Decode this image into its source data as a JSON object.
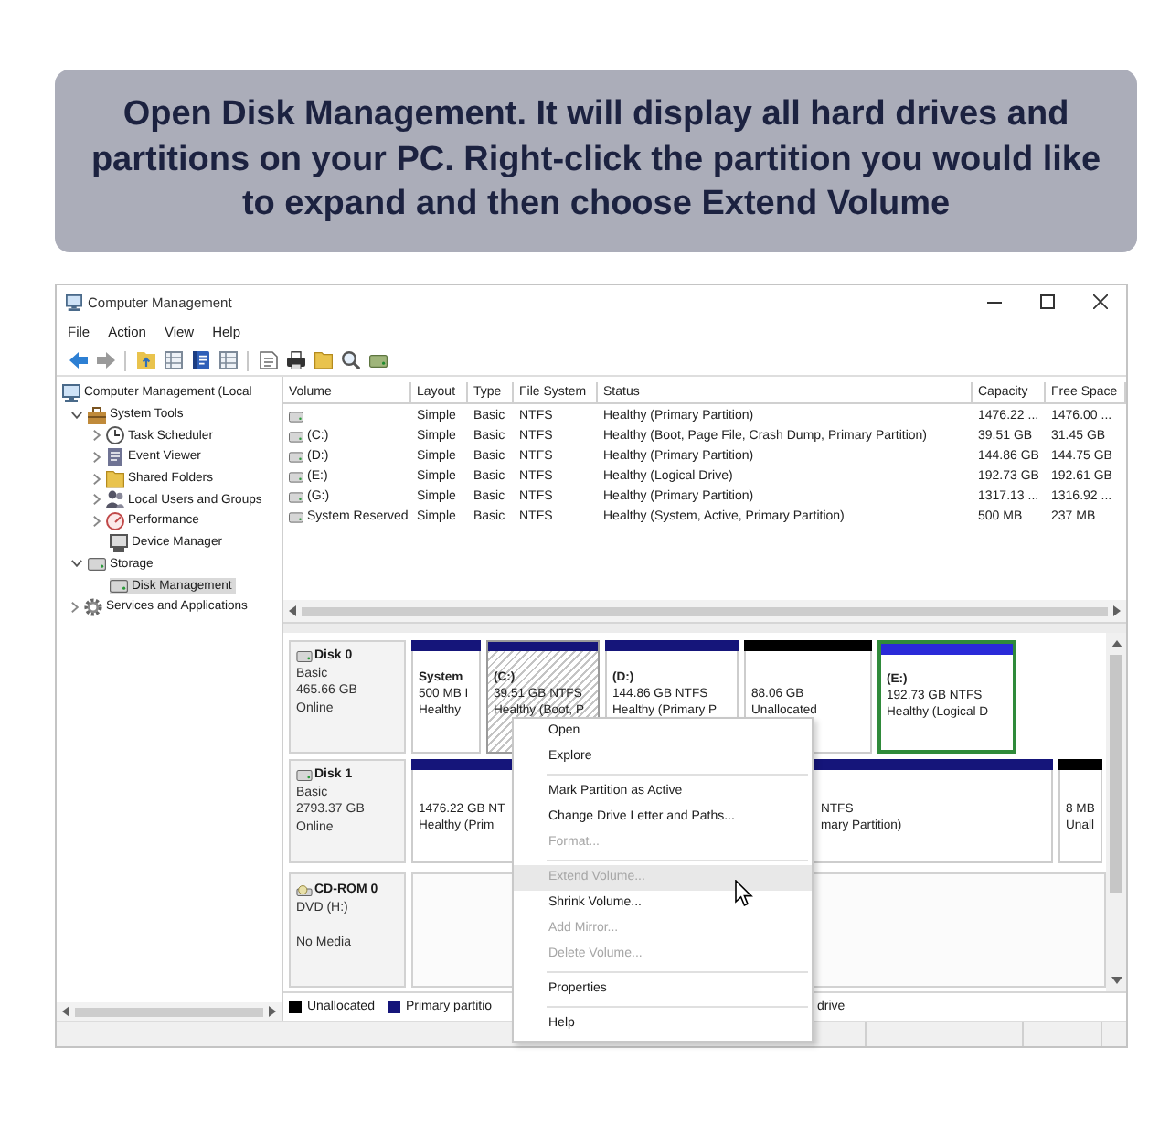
{
  "banner": {
    "text": "Open Disk Management. It will display all hard drives and partitions on your PC. Right-click the partition you would like to expand and then choose Extend Volume"
  },
  "window": {
    "title": "Computer Management"
  },
  "menu_bar": [
    "File",
    "Action",
    "View",
    "Help"
  ],
  "tree": [
    {
      "label": "Computer Management (Local",
      "selected": false,
      "children": [
        {
          "label": "System Tools",
          "selected": false,
          "expanded": true,
          "children": [
            {
              "label": "Task Scheduler",
              "selected": false,
              "expanded": false
            },
            {
              "label": "Event Viewer",
              "selected": false,
              "expanded": false
            },
            {
              "label": "Shared Folders",
              "selected": false,
              "expanded": false
            },
            {
              "label": "Local Users and Groups",
              "selected": false,
              "expanded": false
            },
            {
              "label": "Performance",
              "selected": false,
              "expanded": false
            },
            {
              "label": "Device Manager",
              "selected": false
            }
          ]
        },
        {
          "label": "Storage",
          "selected": false,
          "expanded": true,
          "children": [
            {
              "label": "Disk Management",
              "selected": true
            }
          ]
        },
        {
          "label": "Services and Applications",
          "selected": false,
          "expanded": false
        }
      ]
    }
  ],
  "volume_table": {
    "columns": [
      "Volume",
      "Layout",
      "Type",
      "File System",
      "Status",
      "Capacity",
      "Free Space"
    ],
    "rows": [
      {
        "layout": "Simple",
        "type": "Basic",
        "file_system": "NTFS",
        "status": "Healthy (Primary Partition)",
        "capacity": "1476.22 ...",
        "free_space": "1476.00 ..."
      },
      {
        "volume": "(C:)",
        "layout": "Simple",
        "type": "Basic",
        "file_system": "NTFS",
        "status": "Healthy (Boot, Page File, Crash Dump, Primary Partition)",
        "capacity": "39.51 GB",
        "free_space": "31.45 GB"
      },
      {
        "volume": "(D:)",
        "layout": "Simple",
        "type": "Basic",
        "file_system": "NTFS",
        "status": "Healthy (Primary Partition)",
        "capacity": "144.86 GB",
        "free_space": "144.75 GB"
      },
      {
        "volume": "(E:)",
        "layout": "Simple",
        "type": "Basic",
        "file_system": "NTFS",
        "status": "Healthy (Logical Drive)",
        "capacity": "192.73 GB",
        "free_space": "192.61 GB"
      },
      {
        "volume": "(G:)",
        "layout": "Simple",
        "type": "Basic",
        "file_system": "NTFS",
        "status": "Healthy (Primary Partition)",
        "capacity": "1317.13 ...",
        "free_space": "1316.92 ..."
      },
      {
        "volume": "System Reserved",
        "layout": "Simple",
        "type": "Basic",
        "file_system": "NTFS",
        "status": "Healthy (System, Active, Primary Partition)",
        "capacity": "500 MB",
        "free_space": "237 MB"
      }
    ]
  },
  "disks": [
    {
      "name": "Disk 0",
      "kind": "disk",
      "lines": [
        "Basic",
        "465.66 GB",
        "Online"
      ],
      "partitions": [
        {
          "kind": "primary",
          "title": "System",
          "lines": [
            "500 MB I",
            "Healthy"
          ],
          "selected": false
        },
        {
          "kind": "primary",
          "title": "(C:)",
          "lines": [
            "39.51 GB NTFS",
            "Healthy (Boot, P"
          ],
          "selected": true
        },
        {
          "kind": "primary",
          "title": "(D:)",
          "lines": [
            "144.86 GB NTFS",
            "Healthy (Primary P"
          ],
          "selected": false
        },
        {
          "kind": "unallocated",
          "lines": [
            "88.06 GB",
            "Unallocated"
          ],
          "selected": false
        },
        {
          "kind": "logical",
          "title": "(E:)",
          "lines": [
            "192.73 GB NTFS",
            "Healthy (Logical D"
          ],
          "selected": false
        }
      ]
    },
    {
      "name": "Disk 1",
      "kind": "disk",
      "lines": [
        "Basic",
        "2793.37 GB",
        "Online"
      ],
      "partitions": [
        {
          "kind": "primary",
          "lines": [
            "1476.22 GB NT",
            "Healthy (Prim"
          ],
          "selected": false
        },
        {
          "kind": "primary",
          "lines": [
            "NTFS",
            "mary Partition)"
          ],
          "selected": false
        },
        {
          "kind": "unallocated",
          "lines": [
            "8 MB",
            "Unall"
          ],
          "selected": false
        }
      ]
    },
    {
      "name": "CD-ROM 0",
      "kind": "cdrom",
      "lines": [
        "DVD (H:)",
        "No Media"
      ]
    }
  ],
  "legend": [
    {
      "kind": "unallocated",
      "label": "Unallocated"
    },
    {
      "kind": "primary",
      "label": "Primary partitio"
    },
    {
      "label": "drive"
    }
  ],
  "context_menu": {
    "groups": [
      [
        {
          "label": "Open",
          "disabled": false,
          "selected": false
        },
        {
          "label": "Explore",
          "disabled": false,
          "selected": false
        }
      ],
      [
        {
          "label": "Mark Partition as Active",
          "disabled": false,
          "selected": false
        },
        {
          "label": "Change Drive Letter and Paths...",
          "disabled": false,
          "selected": false
        },
        {
          "label": "Format...",
          "disabled": true,
          "selected": false
        }
      ],
      [
        {
          "label": "Extend Volume...",
          "disabled": true,
          "selected": true
        },
        {
          "label": "Shrink Volume...",
          "disabled": false,
          "selected": false
        },
        {
          "label": "Add Mirror...",
          "disabled": true,
          "selected": false
        },
        {
          "label": "Delete Volume...",
          "disabled": true,
          "selected": false
        }
      ],
      [
        {
          "label": "Properties",
          "disabled": false,
          "selected": false
        }
      ],
      [
        {
          "label": "Help",
          "disabled": false,
          "selected": false
        }
      ]
    ]
  }
}
